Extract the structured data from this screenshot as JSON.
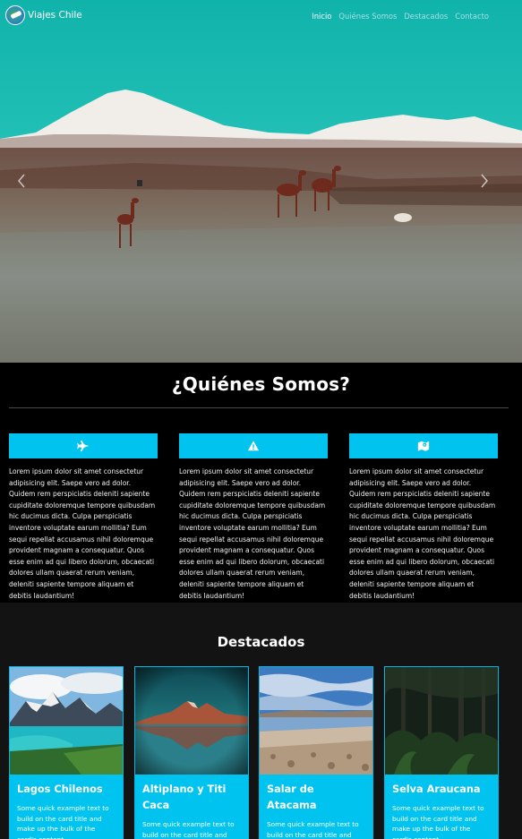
{
  "navbar": {
    "brand": "Viajes Chile",
    "links": [
      "Inicio",
      "Quiénes Somos",
      "Destacados",
      "Contacto"
    ]
  },
  "hero": {
    "icons": [
      "chevron-left-icon",
      "chevron-right-icon"
    ]
  },
  "about": {
    "title": "¿Quiénes Somos?",
    "features": [
      {
        "icon": "plane-icon",
        "text": "Lorem ipsum dolor sit amet consectetur adipisicing elit. Saepe vero ad dolor. Quidem rem perspiciatis deleniti sapiente cupiditate doloremque tempore quibusdam hic ducimus dicta. Culpa perspiciatis inventore voluptate earum mollitia? Eum sequi repellat accusamus nihil doloremque provident magnam a consequatur. Quos esse enim ad qui libero dolorum, obcaecati dolores ullam quaerat rerum veniam, deleniti sapiente tempore aliquam et debitis laudantium!"
      },
      {
        "icon": "warning-triangle-icon",
        "text": "Lorem ipsum dolor sit amet consectetur adipisicing elit. Saepe vero ad dolor. Quidem rem perspiciatis deleniti sapiente cupiditate doloremque tempore quibusdam hic ducimus dicta. Culpa perspiciatis inventore voluptate earum mollitia? Eum sequi repellat accusamus nihil doloremque provident magnam a consequatur. Quos esse enim ad qui libero dolorum, obcaecati dolores ullam quaerat rerum veniam, deleniti sapiente tempore aliquam et debitis laudantium!"
      },
      {
        "icon": "map-icon",
        "text": "Lorem ipsum dolor sit amet consectetur adipisicing elit. Saepe vero ad dolor. Quidem rem perspiciatis deleniti sapiente cupiditate doloremque tempore quibusdam hic ducimus dicta. Culpa perspiciatis inventore voluptate earum mollitia? Eum sequi repellat accusamus nihil doloremque provident magnam a consequatur. Quos esse enim ad qui libero dolorum, obcaecati dolores ullam quaerat rerum veniam, deleniti sapiente tempore aliquam et debitis laudantium!"
      }
    ]
  },
  "featured": {
    "title": "Destacados",
    "cards": [
      {
        "title": "Lagos Chilenos",
        "text": "Some quick example text to build on the card title and make up the bulk of the card's content."
      },
      {
        "title": "Altiplano y Titi Caca",
        "text": "Some quick example text to build on the card title and make up the bulk of the card's content."
      },
      {
        "title": "Salar de Atacama",
        "text": "Some quick example text to build on the card title and make up the bulk of the card's content."
      },
      {
        "title": "Selva Araucana",
        "text": "Some quick example text to build on the card title and make up the bulk of the card's content."
      }
    ]
  },
  "colors": {
    "accent": "#00c3ef",
    "background": "#000000",
    "section_dark": "#131313",
    "nav_link": "#a7dfe8"
  }
}
